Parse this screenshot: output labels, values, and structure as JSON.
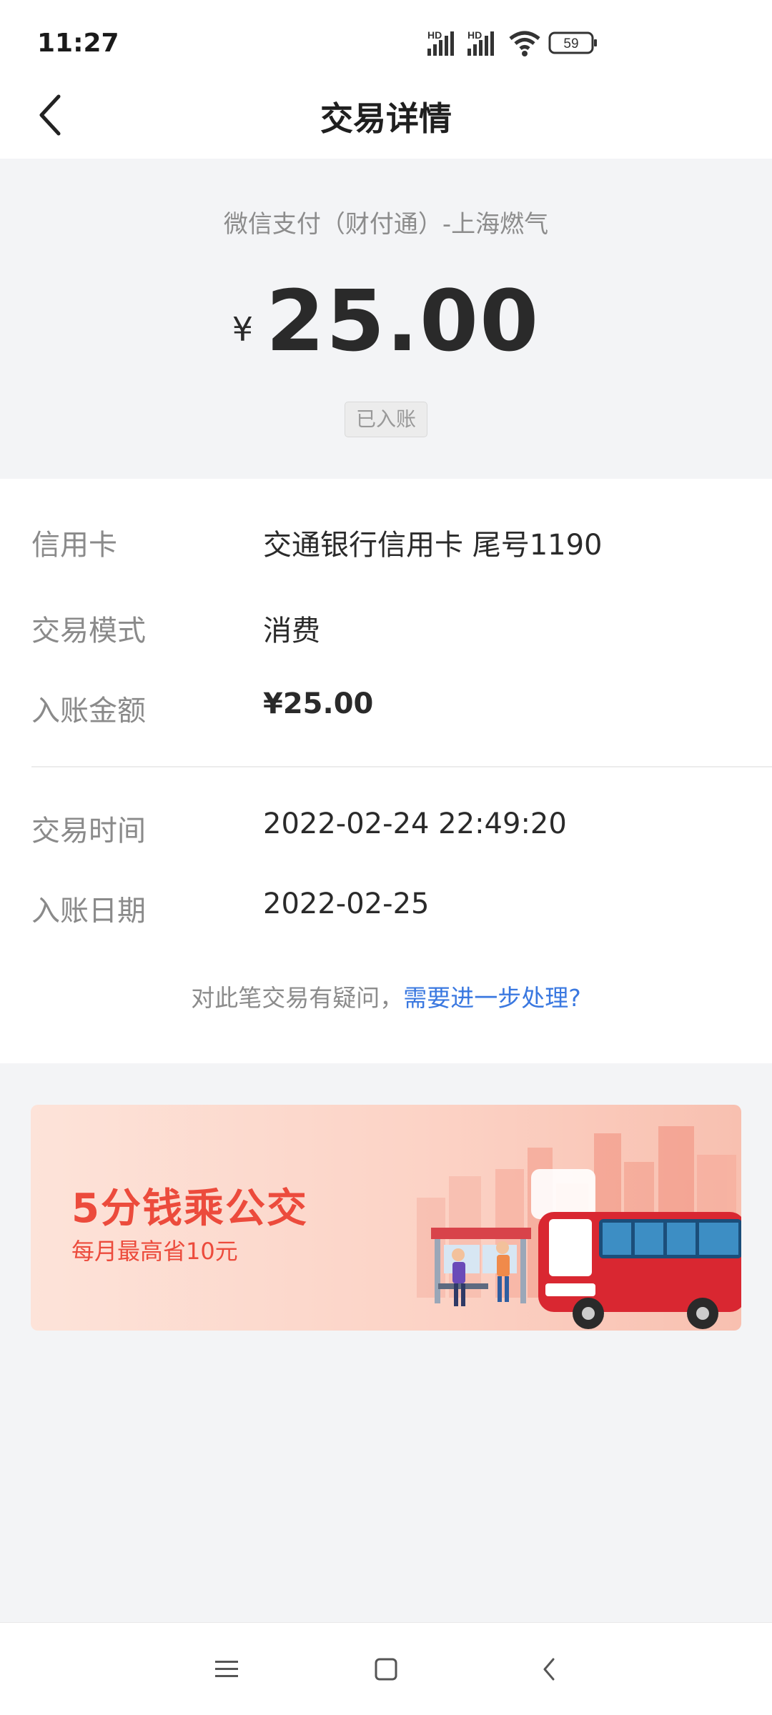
{
  "status_bar": {
    "time": "11:27",
    "signal1_label": "HD",
    "signal2_label": "HD",
    "battery": "59",
    "icons": [
      "signal-icon",
      "signal-icon",
      "wifi-icon",
      "battery-icon"
    ]
  },
  "nav": {
    "title": "交易详情",
    "back_icon": "back-arrow-icon"
  },
  "summary": {
    "merchant": "微信支付（财付通）-上海燃气",
    "currency_symbol": "¥",
    "amount": "25.00",
    "status": "已入账"
  },
  "details": {
    "rows": [
      {
        "label": "信用卡",
        "value": "交通银行信用卡 尾号1190"
      },
      {
        "label": "交易模式",
        "value": "消费"
      },
      {
        "label": "入账金额",
        "value": "¥25.00"
      },
      {
        "label": "交易时间",
        "value": "2022-02-24 22:49:20"
      },
      {
        "label": "入账日期",
        "value": "2022-02-25"
      }
    ],
    "query_text": "对此笔交易有疑问，",
    "query_link": "需要进一步处理?"
  },
  "banner": {
    "title": "5分钱乘公交",
    "subtitle": "每月最高省10元"
  },
  "system_nav": {
    "icons": [
      "menu-icon",
      "home-icon",
      "back-icon"
    ]
  },
  "colors": {
    "accent_link": "#3a78e0",
    "banner_text": "#ec4b3c",
    "page_bg": "#f3f4f6"
  }
}
